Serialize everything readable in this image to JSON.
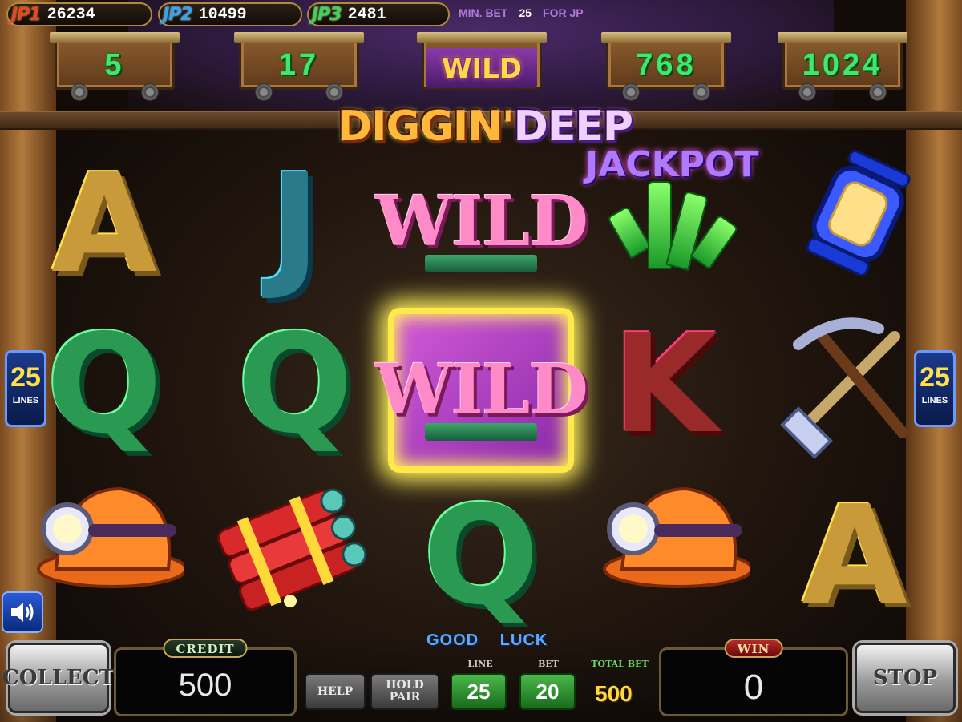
{
  "jackpots": [
    {
      "label": "JP1",
      "value": "26234"
    },
    {
      "label": "JP2",
      "value": "10499"
    },
    {
      "label": "JP3",
      "value": "2481"
    }
  ],
  "min_bet": {
    "prefix": "MIN. BET",
    "value": "25",
    "suffix": "FOR JP"
  },
  "carts": [
    {
      "value": "5"
    },
    {
      "value": "17"
    },
    {
      "value": "WILD"
    },
    {
      "value": "768"
    },
    {
      "value": "1024"
    }
  ],
  "logo": {
    "part1": "DIGGIN'",
    "part2": "DEEP"
  },
  "reels": {
    "row1": [
      "A",
      "J",
      "WILD",
      "JACKPOT",
      "lantern"
    ],
    "row2": [
      "Q",
      "Q",
      "WILD",
      "K",
      "pickaxe-shovel"
    ],
    "row3": [
      "helmet",
      "dynamite",
      "Q",
      "helmet",
      "A"
    ]
  },
  "lines_badge": {
    "value": "25",
    "label": "LINES"
  },
  "controls": {
    "collect": "COLLECT",
    "stop": "STOP",
    "help": "HELP",
    "hold_pair_1": "HOLD",
    "hold_pair_2": "PAIR",
    "credit_label": "CREDIT",
    "credit_value": "500",
    "win_label": "WIN",
    "win_value": "0",
    "good_luck": "GOOD LUCK",
    "line_label": "LINE",
    "line_value": "25",
    "bet_label": "BET",
    "bet_value": "20",
    "total_bet_label": "TOTAL BET",
    "total_bet_value": "500"
  },
  "icons": {
    "speaker": "speaker-icon"
  },
  "colors": {
    "jp1": "#e8452a",
    "jp2": "#3aa0e8",
    "jp3": "#3ed45a",
    "highlight": "#ffe84a"
  }
}
